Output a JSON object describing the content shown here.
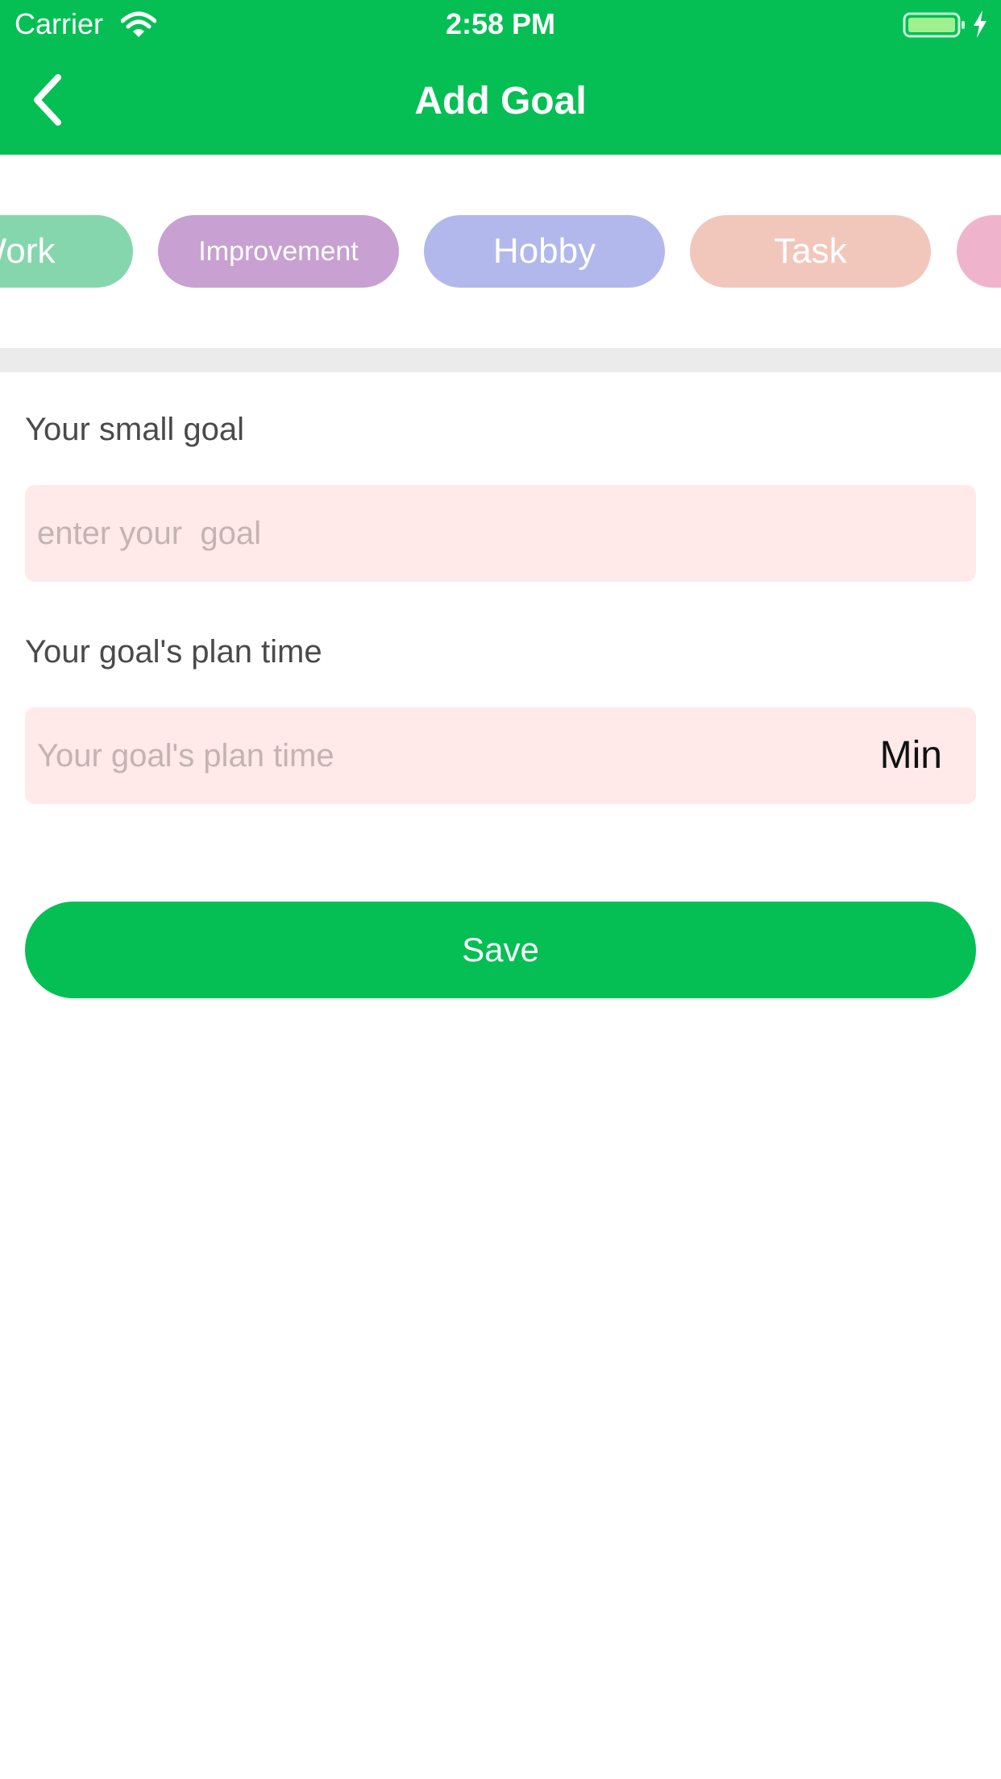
{
  "status_bar": {
    "carrier": "Carrier",
    "time": "2:58 PM"
  },
  "nav": {
    "title": "Add Goal",
    "back_icon": "chevron-left-icon"
  },
  "categories": [
    {
      "label": "Work",
      "color": "#86d6ad"
    },
    {
      "label": "Improvement",
      "color": "#c8a0d1"
    },
    {
      "label": "Hobby",
      "color": "#b2b8ec"
    },
    {
      "label": "Task",
      "color": "#f2c7bb"
    },
    {
      "label": "",
      "color": "#efb4cc"
    }
  ],
  "form": {
    "goal_label": "Your small goal",
    "goal_placeholder": "enter your  goal",
    "goal_value": "",
    "time_label": "Your goal's plan time",
    "time_placeholder": "Your goal's plan time",
    "time_value": "",
    "time_unit": "Min"
  },
  "save_label": "Save",
  "colors": {
    "accent": "#05bf55",
    "input_bg": "#ffe9e9",
    "divider": "#ebebeb"
  }
}
